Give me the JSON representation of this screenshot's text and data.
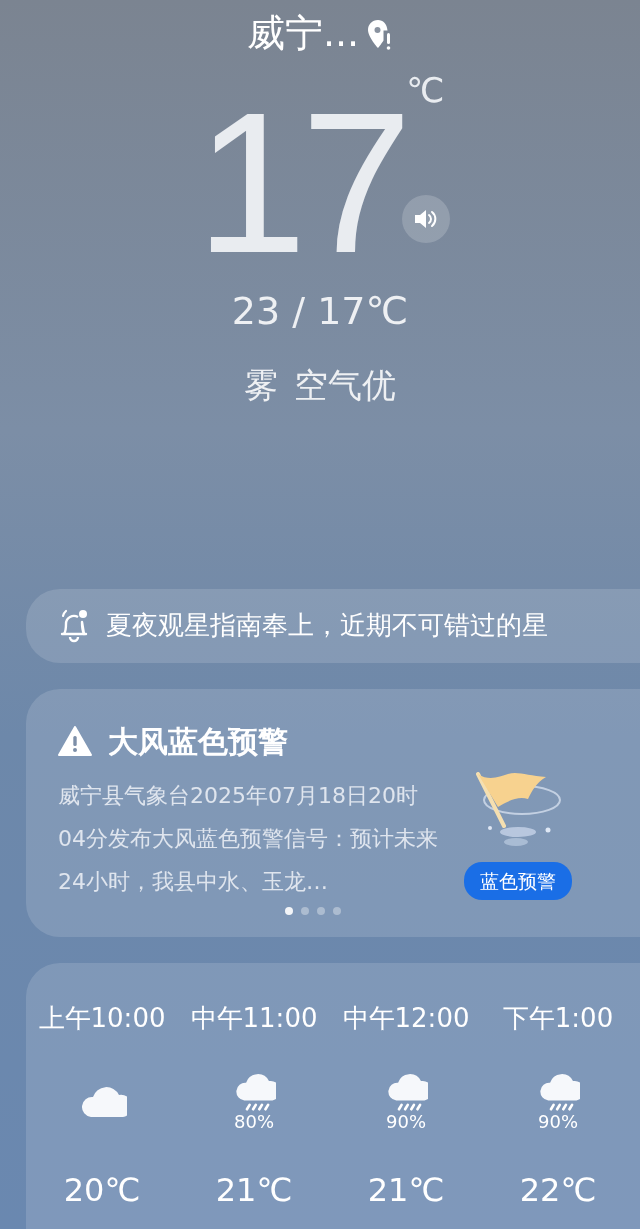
{
  "location": {
    "name": "威宁..."
  },
  "current": {
    "temperature": "17",
    "unit": "℃",
    "range": "23 / 17℃",
    "condition": "雾",
    "air_quality": "空气优"
  },
  "notice": {
    "text": "夏夜观星指南奉上，近期不可错过的星"
  },
  "alert": {
    "title": "大风蓝色预警",
    "body": "威宁县气象台2025年07月18日20时04分发布大风蓝色预警信号：预计未来24小时，我县中水、玉龙…",
    "badge": "蓝色预警",
    "pages": [
      {
        "selected": true
      },
      {
        "selected": false
      },
      {
        "selected": false
      },
      {
        "selected": false
      }
    ]
  },
  "hourly": [
    {
      "time": "上午10:00",
      "kind": "cloudy",
      "temperature": "20℃"
    },
    {
      "time": "中午11:00",
      "kind": "rain",
      "precipitation": "80%",
      "temperature": "21℃"
    },
    {
      "time": "中午12:00",
      "kind": "rain",
      "precipitation": "90%",
      "temperature": "21℃"
    },
    {
      "time": "下午1:00",
      "kind": "rain",
      "precipitation": "90%",
      "temperature": "22℃"
    }
  ]
}
